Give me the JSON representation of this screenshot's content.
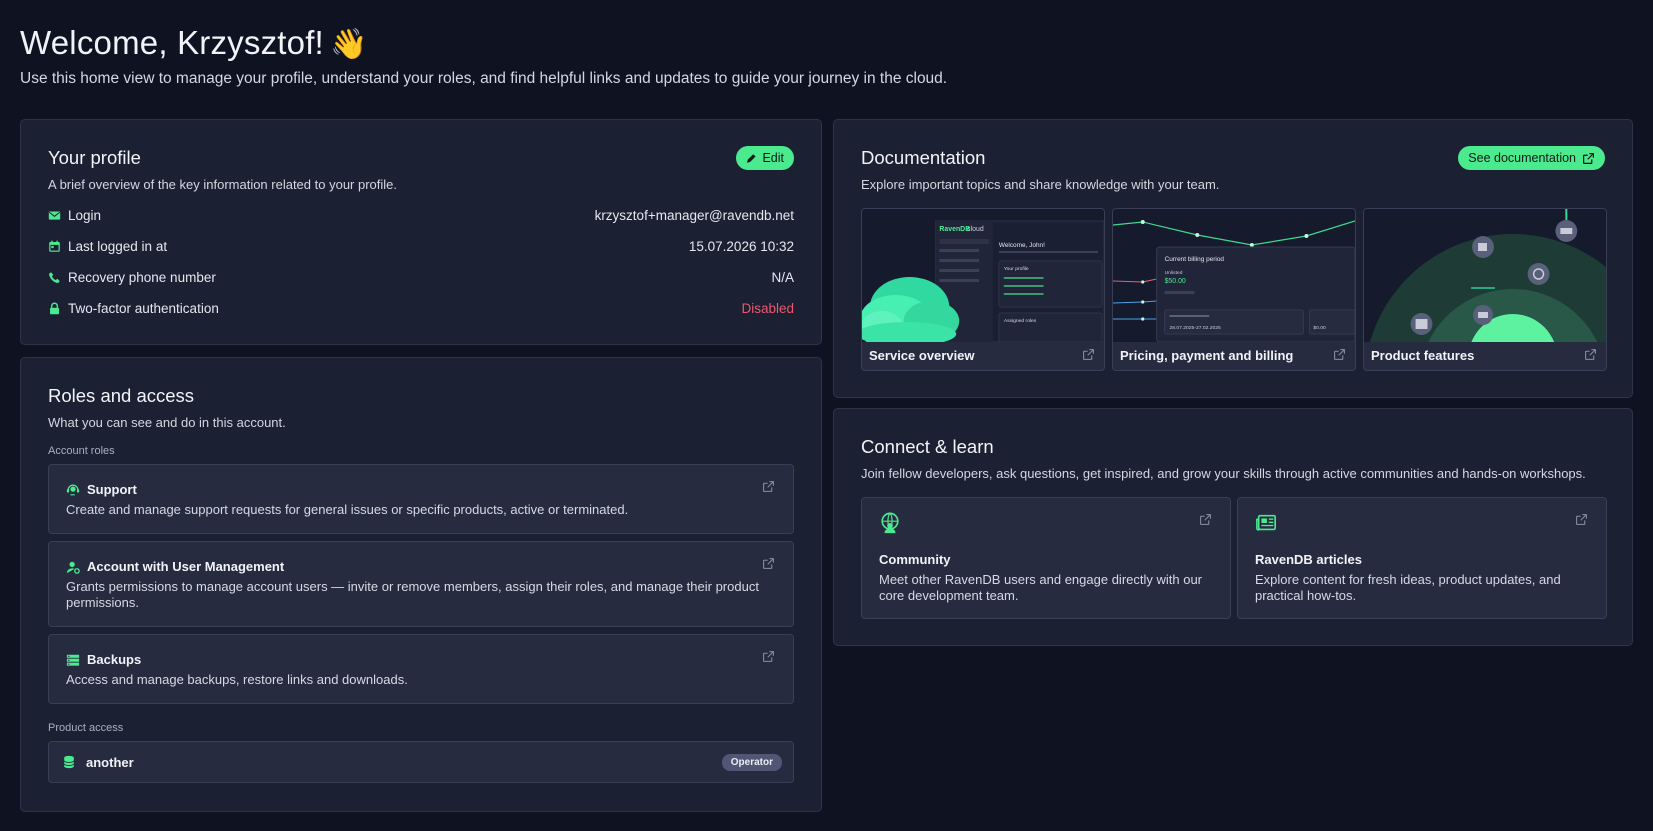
{
  "header": {
    "title": "Welcome, Krzysztof!",
    "wave": "👋",
    "subtitle": "Use this home view to manage your profile, understand your roles, and find helpful links and updates to guide your journey in the cloud."
  },
  "profile": {
    "title": "Your profile",
    "desc": "A brief overview of the key information related to your profile.",
    "edit_label": "Edit",
    "rows": [
      {
        "icon": "mail-icon",
        "label": "Login",
        "value": "krzysztof+manager@ravendb.net"
      },
      {
        "icon": "calendar-icon",
        "label": "Last logged in at",
        "value": "15.07.2026 10:32"
      },
      {
        "icon": "phone-icon",
        "label": "Recovery phone number",
        "value": "N/A"
      },
      {
        "icon": "lock-icon",
        "label": "Two-factor authentication",
        "value": "Disabled"
      }
    ]
  },
  "roles": {
    "title": "Roles and access",
    "desc": "What you can see and do in this account.",
    "account_roles_label": "Account roles",
    "items": [
      {
        "icon": "support-icon",
        "name": "Support",
        "desc": "Create and manage support requests for general issues or specific products, active or terminated."
      },
      {
        "icon": "user-management-icon",
        "name": "Account with User Management",
        "desc": "Grants permissions to manage account users — invite or remove members, assign their roles, and manage their product permissions."
      },
      {
        "icon": "backups-icon",
        "name": "Backups",
        "desc": "Access and manage backups, restore links and downloads."
      }
    ],
    "product_access_label": "Product access",
    "product": {
      "icon": "database-icon",
      "name": "another",
      "badge": "Operator"
    }
  },
  "documentation": {
    "title": "Documentation",
    "desc": "Explore important topics and share knowledge with your team.",
    "button_label": "See documentation",
    "tiles": [
      {
        "caption": "Service overview"
      },
      {
        "caption": "Pricing, payment and billing"
      },
      {
        "caption": "Product features"
      }
    ],
    "thumb_text": {
      "brand": "RavenDB",
      "cloud": "cloud",
      "welcome": "Welcome, John!",
      "profile": "Your profile",
      "assigned": "Assigned roles",
      "billing_period": "Current billing period",
      "unlisted": "Unlisted",
      "amount": "$50.00",
      "date_range": "28.07.2025-27.02.2025",
      "small_amount": "$0.00"
    }
  },
  "connect": {
    "title": "Connect & learn",
    "desc": "Join fellow developers, ask questions, get inspired, and grow your skills through active communities and hands-on workshops.",
    "items": [
      {
        "icon": "community-icon",
        "title": "Community",
        "desc": "Meet other RavenDB users and engage directly with our core development team."
      },
      {
        "icon": "articles-icon",
        "title": "RavenDB articles",
        "desc": "Explore content for fresh ideas, product updates, and practical how-tos."
      }
    ]
  },
  "colors": {
    "accent": "#4bea8f",
    "background": "#0f1321",
    "card": "#1c2033",
    "danger": "#f0566b"
  }
}
